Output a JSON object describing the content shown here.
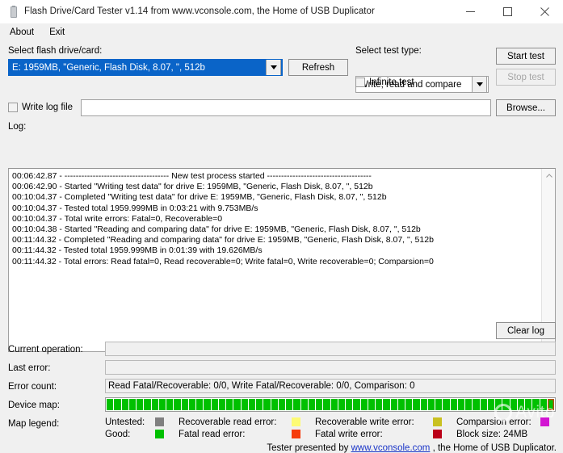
{
  "window": {
    "title": "Flash Drive/Card Tester v1.14 from www.vconsole.com, the Home of USB Duplicator",
    "icon": "usb-drive-icon",
    "minimize": "minimize-icon",
    "maximize": "maximize-icon",
    "close": "close-icon"
  },
  "menu": {
    "items": [
      {
        "label": "About"
      },
      {
        "label": "Exit"
      }
    ]
  },
  "drive": {
    "label": "Select flash drive/card:",
    "selected": "E: 1959MB, \"Generic, Flash Disk, 8.07, \", 512b",
    "refresh_label": "Refresh"
  },
  "test": {
    "label": "Select test type:",
    "selected": "Write, read and compare",
    "infinite_label": "Infinite test",
    "infinite_checked": false,
    "start_label": "Start test",
    "stop_label": "Stop test",
    "stop_disabled": true
  },
  "logfile": {
    "label": "Write log file",
    "checked": false,
    "value": "",
    "placeholder": "",
    "browse_label": "Browse..."
  },
  "log": {
    "label": "Log:",
    "clear_label": "Clear log",
    "lines": [
      "00:06:42.87 - ------------------------------------- New test process started -------------------------------------",
      "00:06:42.90 - Started \"Writing test data\" for drive E: 1959MB, \"Generic, Flash Disk, 8.07, \", 512b",
      "00:10:04.37 - Completed \"Writing test data\" for drive E: 1959MB, \"Generic, Flash Disk, 8.07, \", 512b",
      "00:10:04.37 - Tested total 1959.999MB in 0:03:21 with  9.753MB/s",
      "00:10:04.37 - Total write errors: Fatal=0, Recoverable=0",
      "00:10:04.38 - Started \"Reading and comparing data\" for drive E: 1959MB, \"Generic, Flash Disk, 8.07, \", 512b",
      "00:11:44.32 - Completed \"Reading and comparing data\" for drive E: 1959MB, \"Generic, Flash Disk, 8.07, \", 512b",
      "00:11:44.32 - Tested total 1959.999MB in 0:01:39 with 19.626MB/s",
      "00:11:44.32 - Total errors: Read fatal=0, Read recoverable=0; Write fatal=0, Write recoverable=0; Comparsion=0"
    ]
  },
  "status": {
    "current_operation_label": "Current operation:",
    "current_operation_value": "",
    "last_error_label": "Last error:",
    "last_error_value": "",
    "error_count_label": "Error count:",
    "error_count_value": "Read Fatal/Recoverable: 0/0, Write Fatal/Recoverable: 0/0, Comparison: 0",
    "device_map_label": "Device map:",
    "map_legend_label": "Map legend:"
  },
  "device_map": {
    "blocks": 60,
    "good_color": "#00c000",
    "last_block_color": "#00c000",
    "last_block_border": "#b4510a"
  },
  "legend": {
    "rows": [
      [
        {
          "label": "Untested:",
          "color": "#808080"
        },
        {
          "label": "Recoverable read error:",
          "color": "#fdfb74"
        },
        {
          "label": "Recoverable write error:",
          "color": "#c9c121"
        },
        {
          "label": "Comparsion error:",
          "color": "#d215d2"
        }
      ],
      [
        {
          "label": "Good:",
          "color": "#00c000"
        },
        {
          "label": "Fatal read error:",
          "color": "#f63c0c"
        },
        {
          "label": "Fatal write error:",
          "color": "#ba0018"
        },
        {
          "label": "Block size: 24MB",
          "color": null
        }
      ]
    ]
  },
  "footer": {
    "prefix": "Tester presented by ",
    "link": "www.vconsole.com",
    "suffix": " , the Home of USB Duplicator.",
    "watermark": "Avito"
  }
}
